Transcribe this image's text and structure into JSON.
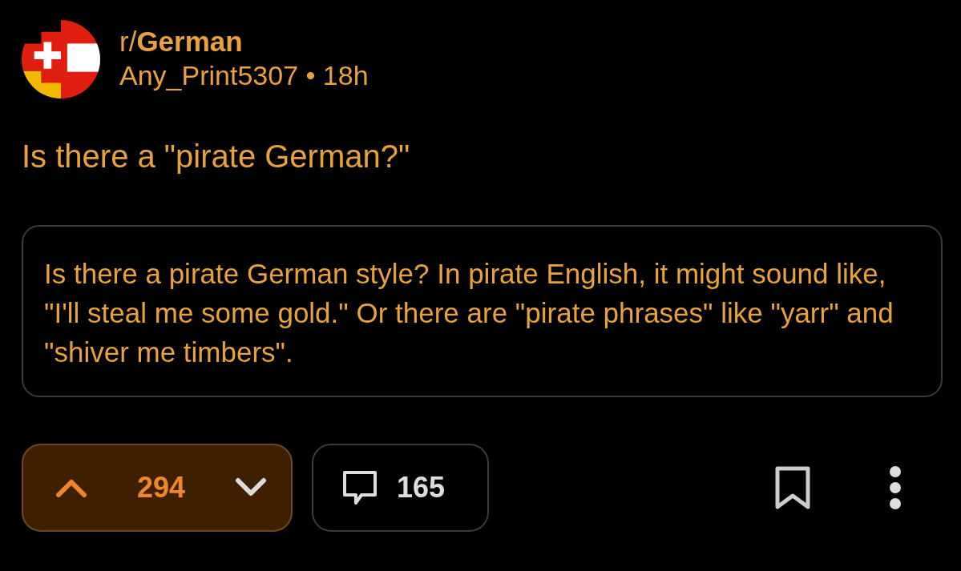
{
  "post": {
    "subreddit_prefix": "r/",
    "subreddit": "German",
    "author": "Any_Print5307",
    "separator": "•",
    "age": "18h",
    "title": "Is there a \"pirate German?\"",
    "body": "Is there a pirate German style? In pirate English, it might sound like, \"I'll steal me some gold.\" Or there are \"pirate phrases\" like \"yarr\" and \"shiver me timbers\"."
  },
  "actions": {
    "vote": {
      "score": "294",
      "upvoted": true
    },
    "comments": {
      "count": "165"
    }
  }
}
